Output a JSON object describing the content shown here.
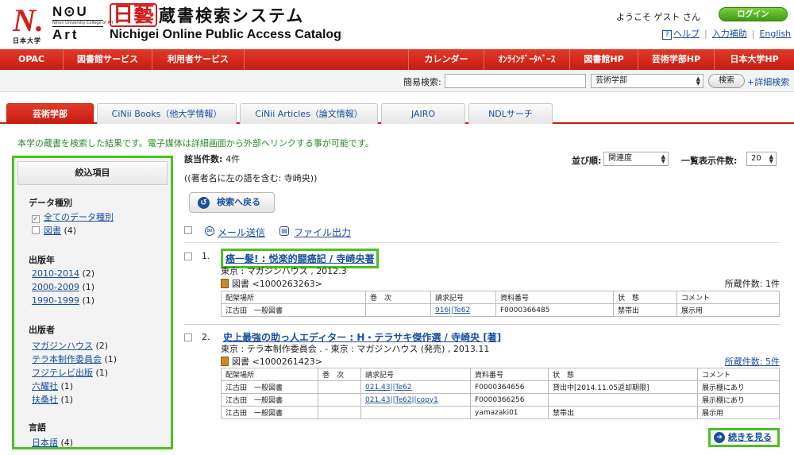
{
  "header": {
    "logo_mark": "N.",
    "logo_caption": "日本大学",
    "nu_top": "N⊙U",
    "nu_mid": "Nihon University College of Art",
    "nu_bottom": "Art",
    "nichigei_mark": "日藝",
    "system_title": "蔵書検索システム",
    "system_subtitle": "Nichigei Online Public Access Catalog",
    "welcome": "ようこそ ゲスト さん",
    "login_label": "ログイン",
    "help_q": "?",
    "help_label": "ヘルプ",
    "input_assist_label": "入力補助",
    "english_label": "English"
  },
  "nav": {
    "opac": "OPAC",
    "library_services": "図書館サービス",
    "user_services": "利用者サービス",
    "calendar": "カレンダー",
    "online_database": "ｵﾝﾗｲﾝﾃﾞｰﾀﾍﾞｰｽ",
    "library_hp": "図書館HP",
    "faculty_hp": "芸術学部HP",
    "univ_hp": "日本大学HP"
  },
  "search": {
    "label": "簡易検索:",
    "value": "",
    "scope": "芸術学部",
    "button": "検索",
    "advanced": "+詳細検索"
  },
  "tabs": [
    {
      "label": "芸術学部"
    },
    {
      "label": "CiNii Books（他大学情報）"
    },
    {
      "label": "CiNii Articles（論文情報）"
    },
    {
      "label": "JAIRO"
    },
    {
      "label": "NDLサーチ"
    }
  ],
  "intro": "本学の蔵書を検索した結果です。電子媒体は詳細画面から外部へリンクする事が可能です。",
  "sidebar": {
    "header": "絞込項目",
    "data_type_title": "データ種別",
    "data_type_all": "全てのデータ種別",
    "data_type_book": "図書",
    "data_type_book_count": "(4)",
    "year_title": "出版年",
    "years": [
      {
        "label": "2010-2014",
        "count": "(2)"
      },
      {
        "label": "2000-2009",
        "count": "(1)"
      },
      {
        "label": "1990-1999",
        "count": "(1)"
      }
    ],
    "publisher_title": "出版者",
    "publishers": [
      {
        "label": "マガジンハウス",
        "count": "(2)"
      },
      {
        "label": "テラ本制作委員会",
        "count": "(1)"
      },
      {
        "label": "フジテレビ出版",
        "count": "(1)"
      },
      {
        "label": "六耀社",
        "count": "(1)"
      },
      {
        "label": "扶桑社",
        "count": "(1)"
      }
    ],
    "language_title": "言語",
    "language": {
      "label": "日本語",
      "count": "(4)"
    }
  },
  "results": {
    "count_label": "該当件数:",
    "count_value": "4件",
    "query": "((著者名に左の語を含む: 寺崎央))",
    "sort_label": "並び順:",
    "sort_value": "関連度",
    "perpage_label": "一覧表示件数:",
    "perpage_value": "20",
    "back_label": "検索へ戻る",
    "mail_label": "メール送信",
    "file_label": "ファイル出力",
    "more_label": "続きを見る"
  },
  "records": [
    {
      "num": "1.",
      "title": "癌一髪! : 悦楽的闘癌記 / 寺崎央著",
      "pub": "東京 : マガジンハウス , 2012.3",
      "type": "図書 <1000263263>",
      "holdings": "所蔵件数: 1件",
      "columns": [
        "配架場所",
        "巻　次",
        "請求記号",
        "資料番号",
        "状　態",
        "コメント"
      ],
      "rows": [
        [
          "江古田　一般図書",
          "",
          "916||Te62",
          "F0000366485",
          "禁帯出",
          "展示用"
        ]
      ]
    },
    {
      "num": "2.",
      "title": "史上最強の助っ人エディター : H・テラサキ傑作選 / 寺崎央 [著]",
      "pub": "東京 : テラ本制作委員会 . - 東京 : マガジンハウス (発売) , 2013.11",
      "type": "図書 <1000261423>",
      "holdings": "所蔵件数: 5件",
      "columns": [
        "配架場所",
        "巻　次",
        "請求記号",
        "資料番号",
        "状　態",
        "コメント"
      ],
      "rows": [
        [
          "江古田　一般図書",
          "",
          "021.43||Te62",
          "F0000364656",
          "貸出中[2014.11.05返却期限]",
          "展示棚にあり"
        ],
        [
          "江古田　一般図書",
          "",
          "021.43||Te62||copy1",
          "F0000366256",
          "",
          "展示棚にあり"
        ],
        [
          "江古田　一般図書",
          "",
          "",
          "yamazaki01",
          "禁帯出",
          "展示用"
        ]
      ]
    }
  ],
  "icons": {
    "mail": "mail-icon",
    "file": "file-icon",
    "back": "back-arrow-icon",
    "more": "forward-arrow-icon",
    "book": "book-icon"
  }
}
